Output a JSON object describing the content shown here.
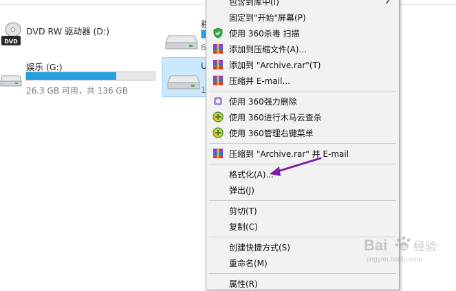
{
  "drives": {
    "dvd": {
      "name": "DVD RW 驱动器 (D:)",
      "icon_label": "DVD"
    },
    "media": {
      "name": "娱乐 (G:)",
      "free_text": "26.3 GB 可用，共 136 GB",
      "used_fraction": 0.7
    },
    "partial_right_1": {
      "name_char": "程",
      "sub_char": "6"
    },
    "partial_right_2": {
      "name_char": "U",
      "sub_char": "1"
    }
  },
  "menu": {
    "items": [
      {
        "label": "包含到库中(I)",
        "icon": "",
        "submenu": true
      },
      {
        "label": "固定到\"开始\"屏幕(P)",
        "icon": ""
      },
      {
        "label": "使用 360杀毒 扫描",
        "icon": "shield-360-icon"
      },
      {
        "label": "添加到压缩文件(A)...",
        "icon": "winrar-icon"
      },
      {
        "label": "添加到 \"Archive.rar\"(T)",
        "icon": "winrar-icon"
      },
      {
        "label": "压缩并 E-mail...",
        "icon": "winrar-icon"
      },
      {
        "label": "使用 360强力删除",
        "icon": "360-delete-icon"
      },
      {
        "label": "使用 360进行木马云查杀",
        "icon": "360-cloud-icon"
      },
      {
        "label": "使用 360管理右键菜单",
        "icon": "360-menu-icon"
      },
      {
        "label": "压缩到 \"Archive.rar\" 并 E-mail",
        "icon": "winrar-icon"
      },
      {
        "label": "格式化(A)...",
        "icon": ""
      },
      {
        "label": "弹出(J)",
        "icon": ""
      },
      {
        "label": "剪切(T)",
        "icon": ""
      },
      {
        "label": "复制(C)",
        "icon": ""
      },
      {
        "label": "创建快捷方式(S)",
        "icon": ""
      },
      {
        "label": "重命名(M)",
        "icon": ""
      },
      {
        "label": "属性(R)",
        "icon": ""
      }
    ]
  },
  "annotation": {
    "arrow_color": "#7b1fa2"
  },
  "watermark": {
    "brand": "Bai",
    "paw": "du",
    "sub": "jingyan.baidu.com"
  },
  "colors": {
    "accent": "#26a0da",
    "selection": "#cce8ff",
    "menu_bg": "#f2f2f2"
  }
}
